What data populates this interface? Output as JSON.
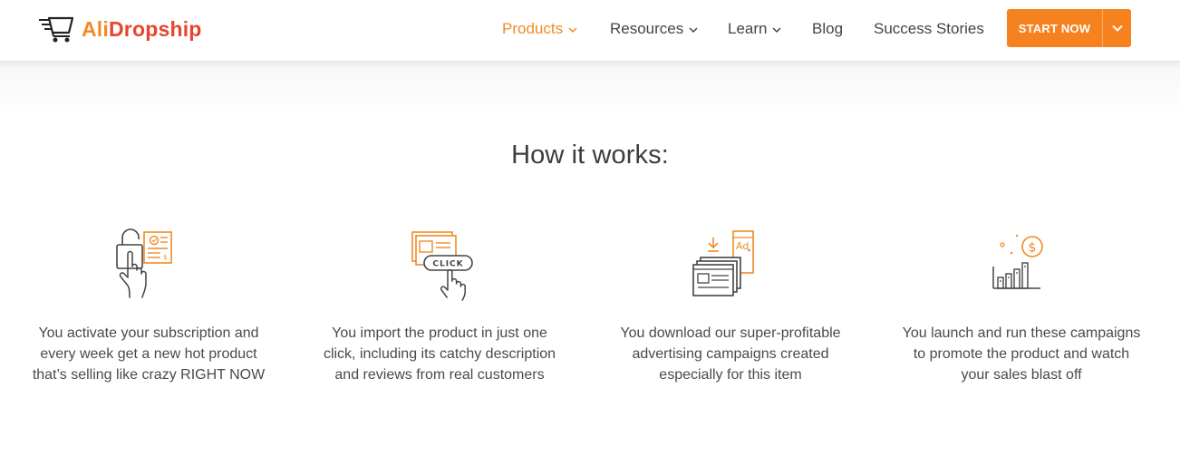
{
  "brand": {
    "name_part1": "Ali",
    "name_part2": "Dropship"
  },
  "colors": {
    "accent": "#f5821f",
    "brand_red": "#e8452c",
    "icon_orange": "#f08a24",
    "icon_dark": "#444444"
  },
  "nav": {
    "items": [
      {
        "label": "Products",
        "has_dropdown": true,
        "active": true
      },
      {
        "label": "Resources",
        "has_dropdown": true,
        "active": false
      },
      {
        "label": "Learn",
        "has_dropdown": true,
        "active": false
      },
      {
        "label": "Blog",
        "has_dropdown": false,
        "active": false
      },
      {
        "label": "Success Stories",
        "has_dropdown": false,
        "active": false
      }
    ],
    "cta_label": "START NOW"
  },
  "section": {
    "heading": "How it works:",
    "steps": [
      {
        "icon": "unlock-hand-icon",
        "text": "You activate your subscription and every week get a new hot product that’s selling like crazy RIGHT NOW"
      },
      {
        "icon": "click-import-icon",
        "text": "You import the product in just one click, including its catchy description and reviews from real customers"
      },
      {
        "icon": "ad-download-icon",
        "text": "You download our super-profitable advertising campaigns created especially for this item"
      },
      {
        "icon": "sales-growth-icon",
        "text": "You launch and run these campaigns to promote the product and watch your sales blast off"
      }
    ]
  }
}
